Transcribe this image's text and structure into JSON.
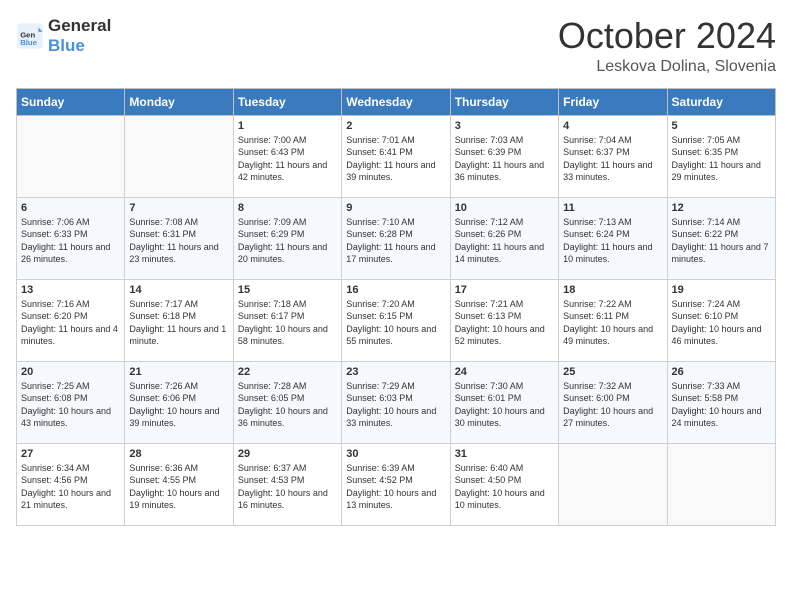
{
  "header": {
    "logo_general": "General",
    "logo_blue": "Blue",
    "month_year": "October 2024",
    "location": "Leskova Dolina, Slovenia"
  },
  "days_of_week": [
    "Sunday",
    "Monday",
    "Tuesday",
    "Wednesday",
    "Thursday",
    "Friday",
    "Saturday"
  ],
  "weeks": [
    [
      {
        "day": "",
        "info": ""
      },
      {
        "day": "",
        "info": ""
      },
      {
        "day": "1",
        "info": "Sunrise: 7:00 AM\nSunset: 6:43 PM\nDaylight: 11 hours and 42 minutes."
      },
      {
        "day": "2",
        "info": "Sunrise: 7:01 AM\nSunset: 6:41 PM\nDaylight: 11 hours and 39 minutes."
      },
      {
        "day": "3",
        "info": "Sunrise: 7:03 AM\nSunset: 6:39 PM\nDaylight: 11 hours and 36 minutes."
      },
      {
        "day": "4",
        "info": "Sunrise: 7:04 AM\nSunset: 6:37 PM\nDaylight: 11 hours and 33 minutes."
      },
      {
        "day": "5",
        "info": "Sunrise: 7:05 AM\nSunset: 6:35 PM\nDaylight: 11 hours and 29 minutes."
      }
    ],
    [
      {
        "day": "6",
        "info": "Sunrise: 7:06 AM\nSunset: 6:33 PM\nDaylight: 11 hours and 26 minutes."
      },
      {
        "day": "7",
        "info": "Sunrise: 7:08 AM\nSunset: 6:31 PM\nDaylight: 11 hours and 23 minutes."
      },
      {
        "day": "8",
        "info": "Sunrise: 7:09 AM\nSunset: 6:29 PM\nDaylight: 11 hours and 20 minutes."
      },
      {
        "day": "9",
        "info": "Sunrise: 7:10 AM\nSunset: 6:28 PM\nDaylight: 11 hours and 17 minutes."
      },
      {
        "day": "10",
        "info": "Sunrise: 7:12 AM\nSunset: 6:26 PM\nDaylight: 11 hours and 14 minutes."
      },
      {
        "day": "11",
        "info": "Sunrise: 7:13 AM\nSunset: 6:24 PM\nDaylight: 11 hours and 10 minutes."
      },
      {
        "day": "12",
        "info": "Sunrise: 7:14 AM\nSunset: 6:22 PM\nDaylight: 11 hours and 7 minutes."
      }
    ],
    [
      {
        "day": "13",
        "info": "Sunrise: 7:16 AM\nSunset: 6:20 PM\nDaylight: 11 hours and 4 minutes."
      },
      {
        "day": "14",
        "info": "Sunrise: 7:17 AM\nSunset: 6:18 PM\nDaylight: 11 hours and 1 minute."
      },
      {
        "day": "15",
        "info": "Sunrise: 7:18 AM\nSunset: 6:17 PM\nDaylight: 10 hours and 58 minutes."
      },
      {
        "day": "16",
        "info": "Sunrise: 7:20 AM\nSunset: 6:15 PM\nDaylight: 10 hours and 55 minutes."
      },
      {
        "day": "17",
        "info": "Sunrise: 7:21 AM\nSunset: 6:13 PM\nDaylight: 10 hours and 52 minutes."
      },
      {
        "day": "18",
        "info": "Sunrise: 7:22 AM\nSunset: 6:11 PM\nDaylight: 10 hours and 49 minutes."
      },
      {
        "day": "19",
        "info": "Sunrise: 7:24 AM\nSunset: 6:10 PM\nDaylight: 10 hours and 46 minutes."
      }
    ],
    [
      {
        "day": "20",
        "info": "Sunrise: 7:25 AM\nSunset: 6:08 PM\nDaylight: 10 hours and 43 minutes."
      },
      {
        "day": "21",
        "info": "Sunrise: 7:26 AM\nSunset: 6:06 PM\nDaylight: 10 hours and 39 minutes."
      },
      {
        "day": "22",
        "info": "Sunrise: 7:28 AM\nSunset: 6:05 PM\nDaylight: 10 hours and 36 minutes."
      },
      {
        "day": "23",
        "info": "Sunrise: 7:29 AM\nSunset: 6:03 PM\nDaylight: 10 hours and 33 minutes."
      },
      {
        "day": "24",
        "info": "Sunrise: 7:30 AM\nSunset: 6:01 PM\nDaylight: 10 hours and 30 minutes."
      },
      {
        "day": "25",
        "info": "Sunrise: 7:32 AM\nSunset: 6:00 PM\nDaylight: 10 hours and 27 minutes."
      },
      {
        "day": "26",
        "info": "Sunrise: 7:33 AM\nSunset: 5:58 PM\nDaylight: 10 hours and 24 minutes."
      }
    ],
    [
      {
        "day": "27",
        "info": "Sunrise: 6:34 AM\nSunset: 4:56 PM\nDaylight: 10 hours and 21 minutes."
      },
      {
        "day": "28",
        "info": "Sunrise: 6:36 AM\nSunset: 4:55 PM\nDaylight: 10 hours and 19 minutes."
      },
      {
        "day": "29",
        "info": "Sunrise: 6:37 AM\nSunset: 4:53 PM\nDaylight: 10 hours and 16 minutes."
      },
      {
        "day": "30",
        "info": "Sunrise: 6:39 AM\nSunset: 4:52 PM\nDaylight: 10 hours and 13 minutes."
      },
      {
        "day": "31",
        "info": "Sunrise: 6:40 AM\nSunset: 4:50 PM\nDaylight: 10 hours and 10 minutes."
      },
      {
        "day": "",
        "info": ""
      },
      {
        "day": "",
        "info": ""
      }
    ]
  ]
}
